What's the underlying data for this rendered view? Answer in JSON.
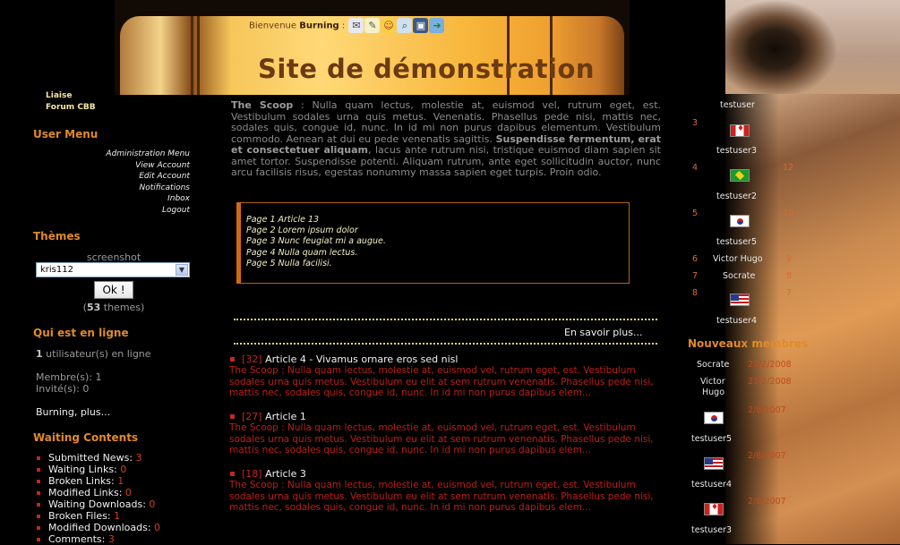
{
  "header": {
    "welcome_prefix": "Bienvenue",
    "username": "Burning",
    "title": "Site de démonstration",
    "toolbar_icons": [
      "mail-icon",
      "notepad-icon",
      "smiley-icon",
      "search-icon",
      "picture-icon",
      "exit-icon"
    ]
  },
  "left": {
    "top_links": [
      "Liaise",
      "Forum CBB"
    ],
    "user_menu": {
      "title": "User Menu",
      "items": [
        "Administration Menu",
        "View Account",
        "Edit Account",
        "Notifications",
        "Inbox",
        "Logout"
      ]
    },
    "themes": {
      "title": "Thèmes",
      "screenshot_label": "screenshot",
      "selected": "kris112",
      "ok_label": "Ok !",
      "count": "53",
      "count_suffix": "themes)",
      "count_prefix": "("
    },
    "online": {
      "title": "Qui est en ligne",
      "count": "1",
      "count_label": "utilisateur(s) en ligne",
      "members": "Membre(s): 1",
      "guests": "Invité(s): 0",
      "user": "Burning,",
      "more": "plus..."
    },
    "waiting": {
      "title": "Waiting Contents",
      "items": [
        {
          "label": "Submitted News",
          "count": "3"
        },
        {
          "label": "Waiting Links",
          "count": "0"
        },
        {
          "label": "Broken Links",
          "count": "1"
        },
        {
          "label": "Modified Links",
          "count": "0"
        },
        {
          "label": "Waiting Downloads",
          "count": "0"
        },
        {
          "label": "Broken Files",
          "count": "1"
        },
        {
          "label": "Modified Downloads",
          "count": "0"
        },
        {
          "label": "Comments",
          "count": "3"
        }
      ]
    }
  },
  "center": {
    "scoop_title": "The Scoop",
    "scoop_a": " : Nulla quam lectus, molestie at, euismod vel, rutrum eget, est. Vestibulum sodales urna quis metus. Venenatis. Phasellus pede nisi, mattis nec, sodales quis, congue id, nunc. In id mi non purus dapibus elementum. Vestibulum commodo. Aenean at dui eu pede venenatis sagittis. ",
    "scoop_bold": "Suspendisse fermentum, erat et consectetuer aliquam",
    "scoop_b": ", lacus ante rutrum nisi, tristique euismod diam sapien sit amet tortor. Suspendisse potenti. Aliquam rutrum, ante eget sollicitudin auctor, nunc arcu facilisis risus, egestas nonummy massa sapien eget turpis. Proin odio.",
    "pages": [
      "Page 1 Article 13",
      "Page 2 Lorem ipsum dolor",
      "Page 3 Nunc feugiat mi a augue.",
      "Page 4 Nulla quam lectus.",
      "Page 5 Nulla facilisi."
    ],
    "more_label": "En savoir plus...",
    "articles": [
      {
        "id": "[32]",
        "title": "Article 4 - Vivamus ornare eros sed nisl",
        "body": "The Scoop : Nulla quam lectus, molestie at, euismod vel, rutrum eget, est. Vestibulum sodales urna quis metus. Vestibulum eu elit at sem rutrum venenatis. Phasellus pede nisi, mattis nec, sodales quis, congue id, nunc. In id mi non purus dapibus elem..."
      },
      {
        "id": "[27]",
        "title": "Article 1",
        "body": "The Scoop : Nulla quam lectus, molestie at, euismod vel, rutrum eget, est. Vestibulum sodales urna quis metus. Vestibulum eu elit at sem rutrum venenatis. Phasellus pede nisi, mattis nec, sodales quis, congue id, nunc. In id mi non purus dapibus elem..."
      },
      {
        "id": "[18]",
        "title": "Article 3",
        "body": "The Scoop : Nulla quam lectus, molestie at, euismod vel, rutrum eget, est. Vestibulum sodales urna quis metus. Vestibulum eu elit at sem rutrum venenatis. Phasellus pede nisi, mattis nec, sodales quis, congue id, nunc. In id mi non purus dapibus elem..."
      }
    ]
  },
  "right": {
    "top_posters": [
      {
        "rank": "",
        "name": "testuser",
        "score": "",
        "flag": ""
      },
      {
        "rank": "3",
        "name": "testuser3",
        "score": "",
        "flag": "ca"
      },
      {
        "rank": "4",
        "name": "testuser2",
        "score": "12",
        "flag": "br"
      },
      {
        "rank": "5",
        "name": "testuser5",
        "score": "10",
        "flag": "kr"
      },
      {
        "rank": "6",
        "name": "Victor Hugo",
        "score": "9",
        "flag": ""
      },
      {
        "rank": "7",
        "name": "Socrate",
        "score": "8",
        "flag": ""
      },
      {
        "rank": "8",
        "name": "testuser4",
        "score": "7",
        "flag": "us"
      }
    ],
    "new_members_title": "Nouveaux membres",
    "new_members": [
      {
        "name": "Socrate",
        "date": "22/2/2008",
        "flag": ""
      },
      {
        "name_line1": "Victor",
        "name_line2": "Hugo",
        "date": "21/2/2008",
        "flag": ""
      },
      {
        "name": "testuser5",
        "date": "2/8/2007",
        "flag": "kr"
      },
      {
        "name": "testuser4",
        "date": "2/8/2007",
        "flag": "us"
      },
      {
        "name": "testuser3",
        "date": "2/8/2007",
        "flag": "ca"
      }
    ]
  }
}
